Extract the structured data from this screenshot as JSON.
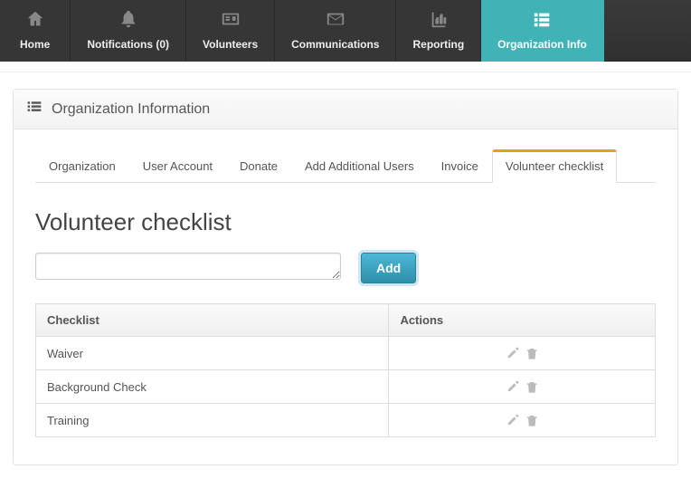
{
  "nav": {
    "items": [
      {
        "label": "Home"
      },
      {
        "label": "Notifications  (0)"
      },
      {
        "label": "Volunteers"
      },
      {
        "label": "Communications"
      },
      {
        "label": "Reporting"
      },
      {
        "label": "Organization Info"
      }
    ]
  },
  "panel": {
    "title": "Organization Information"
  },
  "tabs": [
    {
      "label": "Organization"
    },
    {
      "label": "User Account"
    },
    {
      "label": "Donate"
    },
    {
      "label": "Add Additional Users"
    },
    {
      "label": "Invoice"
    },
    {
      "label": "Volunteer checklist"
    }
  ],
  "page": {
    "title": "Volunteer checklist",
    "add_button": "Add",
    "input_value": ""
  },
  "table": {
    "headers": {
      "checklist": "Checklist",
      "actions": "Actions"
    },
    "rows": [
      {
        "name": "Waiver"
      },
      {
        "name": "Background Check"
      },
      {
        "name": "Training"
      }
    ]
  }
}
